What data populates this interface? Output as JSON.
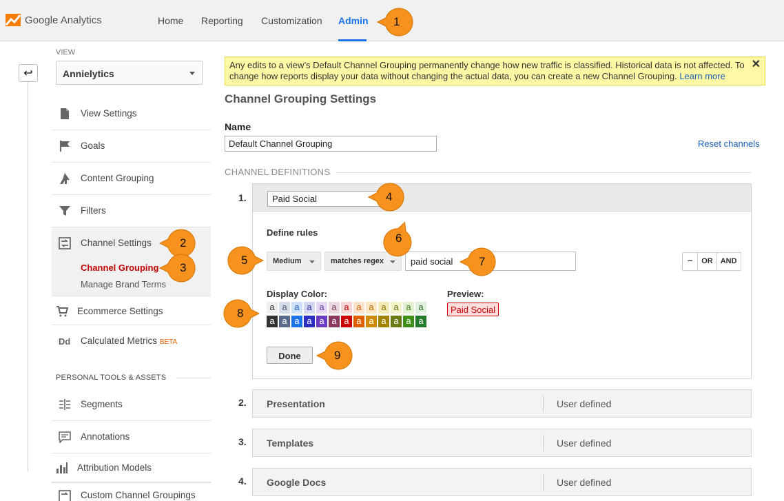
{
  "app": {
    "logo_name": "Google Analytics"
  },
  "nav": {
    "items": [
      {
        "label": "Home"
      },
      {
        "label": "Reporting"
      },
      {
        "label": "Customization"
      },
      {
        "label": "Admin"
      }
    ],
    "active": "Admin"
  },
  "sidebar": {
    "view_label": "VIEW",
    "view_value": "Annielytics",
    "items": [
      {
        "label": "View Settings",
        "icon": "document-icon"
      },
      {
        "label": "Goals",
        "icon": "flag-icon"
      },
      {
        "label": "Content Grouping",
        "icon": "person-walking-icon"
      },
      {
        "label": "Filters",
        "icon": "filter-icon"
      },
      {
        "label": "Channel Settings",
        "icon": "channel-settings-icon"
      },
      {
        "label": "Ecommerce Settings",
        "icon": "cart-icon"
      },
      {
        "label": "Calculated Metrics",
        "badge": "BETA",
        "icon": "dd-icon"
      }
    ],
    "sub_items": [
      {
        "label": "Channel Grouping"
      },
      {
        "label": "Manage Brand Terms"
      }
    ],
    "section_label": "PERSONAL TOOLS & ASSETS",
    "personal_items": [
      {
        "label": "Segments",
        "icon": "segments-icon"
      },
      {
        "label": "Annotations",
        "icon": "comment-icon"
      },
      {
        "label": "Attribution Models",
        "icon": "bar-chart-icon"
      },
      {
        "label": "Custom Channel Groupings",
        "icon": "custom-channel-icon"
      }
    ],
    "icon_dd": "Dd"
  },
  "notice": {
    "text": "Any edits to a view’s Default Channel Grouping permanently change how new traffic is classified. Historical data is not affected. To change how reports display your data without changing the actual data, you can create a new Channel Grouping.",
    "link": "Learn more",
    "close": "✕"
  },
  "page": {
    "title": "Channel Grouping Settings",
    "name_label": "Name",
    "name_value": "Default Channel Grouping",
    "reset_label": "Reset channels",
    "definitions_label": "CHANNEL DEFINITIONS"
  },
  "channel1": {
    "number": "1.",
    "name_value": "Paid Social",
    "define_rules": "Define rules",
    "dimension": "Medium",
    "operator": "matches regex",
    "value": "paid social",
    "logic": [
      "–",
      "OR",
      "AND"
    ],
    "display_color_label": "Display Color:",
    "swatch_letter": "a",
    "preview_label": "Preview:",
    "preview_text": "Paid Social",
    "done_label": "Done"
  },
  "swatch_colors": {
    "light": [
      {
        "bg": "#eeeeee",
        "fg": "#333333"
      },
      {
        "bg": "#d6dde8",
        "fg": "#4a5a78"
      },
      {
        "bg": "#cfe0fb",
        "fg": "#1a5fb4"
      },
      {
        "bg": "#d5d7f6",
        "fg": "#2b2fa8"
      },
      {
        "bg": "#e2d6f2",
        "fg": "#5b3ba0"
      },
      {
        "bg": "#ead8e1",
        "fg": "#7a3355"
      },
      {
        "bg": "#f8d6d6",
        "fg": "#c00000"
      },
      {
        "bg": "#fbe2cc",
        "fg": "#d05a00"
      },
      {
        "bg": "#fbe7c4",
        "fg": "#b56b00"
      },
      {
        "bg": "#f4eab9",
        "fg": "#8a7300"
      },
      {
        "bg": "#f1f4c8",
        "fg": "#5e6a10"
      },
      {
        "bg": "#e3f3d1",
        "fg": "#3b7d10"
      },
      {
        "bg": "#e0f0de",
        "fg": "#2b6b22"
      }
    ],
    "dark": [
      {
        "bg": "#333333",
        "fg": "#ffffff"
      },
      {
        "bg": "#5a6a88",
        "fg": "#ffffff"
      },
      {
        "bg": "#1a73e8",
        "fg": "#ffffff"
      },
      {
        "bg": "#2b2fc0",
        "fg": "#ffffff"
      },
      {
        "bg": "#6a3dc0",
        "fg": "#ffffff"
      },
      {
        "bg": "#8a3a5e",
        "fg": "#ffffff"
      },
      {
        "bg": "#cc0000",
        "fg": "#ffffff"
      },
      {
        "bg": "#e06000",
        "fg": "#ffffff"
      },
      {
        "bg": "#cf8a00",
        "fg": "#ffffff"
      },
      {
        "bg": "#a08400",
        "fg": "#ffffff"
      },
      {
        "bg": "#6a7a14",
        "fg": "#ffffff"
      },
      {
        "bg": "#3e8f17",
        "fg": "#ffffff"
      },
      {
        "bg": "#237a2a",
        "fg": "#ffffff"
      }
    ]
  },
  "channels": [
    {
      "number": "2.",
      "name": "Presentation",
      "type": "User defined"
    },
    {
      "number": "3.",
      "name": "Templates",
      "type": "User defined"
    },
    {
      "number": "4.",
      "name": "Google Docs",
      "type": "User defined"
    }
  ],
  "callouts": [
    "1",
    "2",
    "3",
    "4",
    "5",
    "6",
    "7",
    "8",
    "9"
  ],
  "colors": {
    "accent": "#1a73e8",
    "callout": "#f7921e",
    "notice_bg": "#fff9a6",
    "active_sub": "#c00000"
  }
}
